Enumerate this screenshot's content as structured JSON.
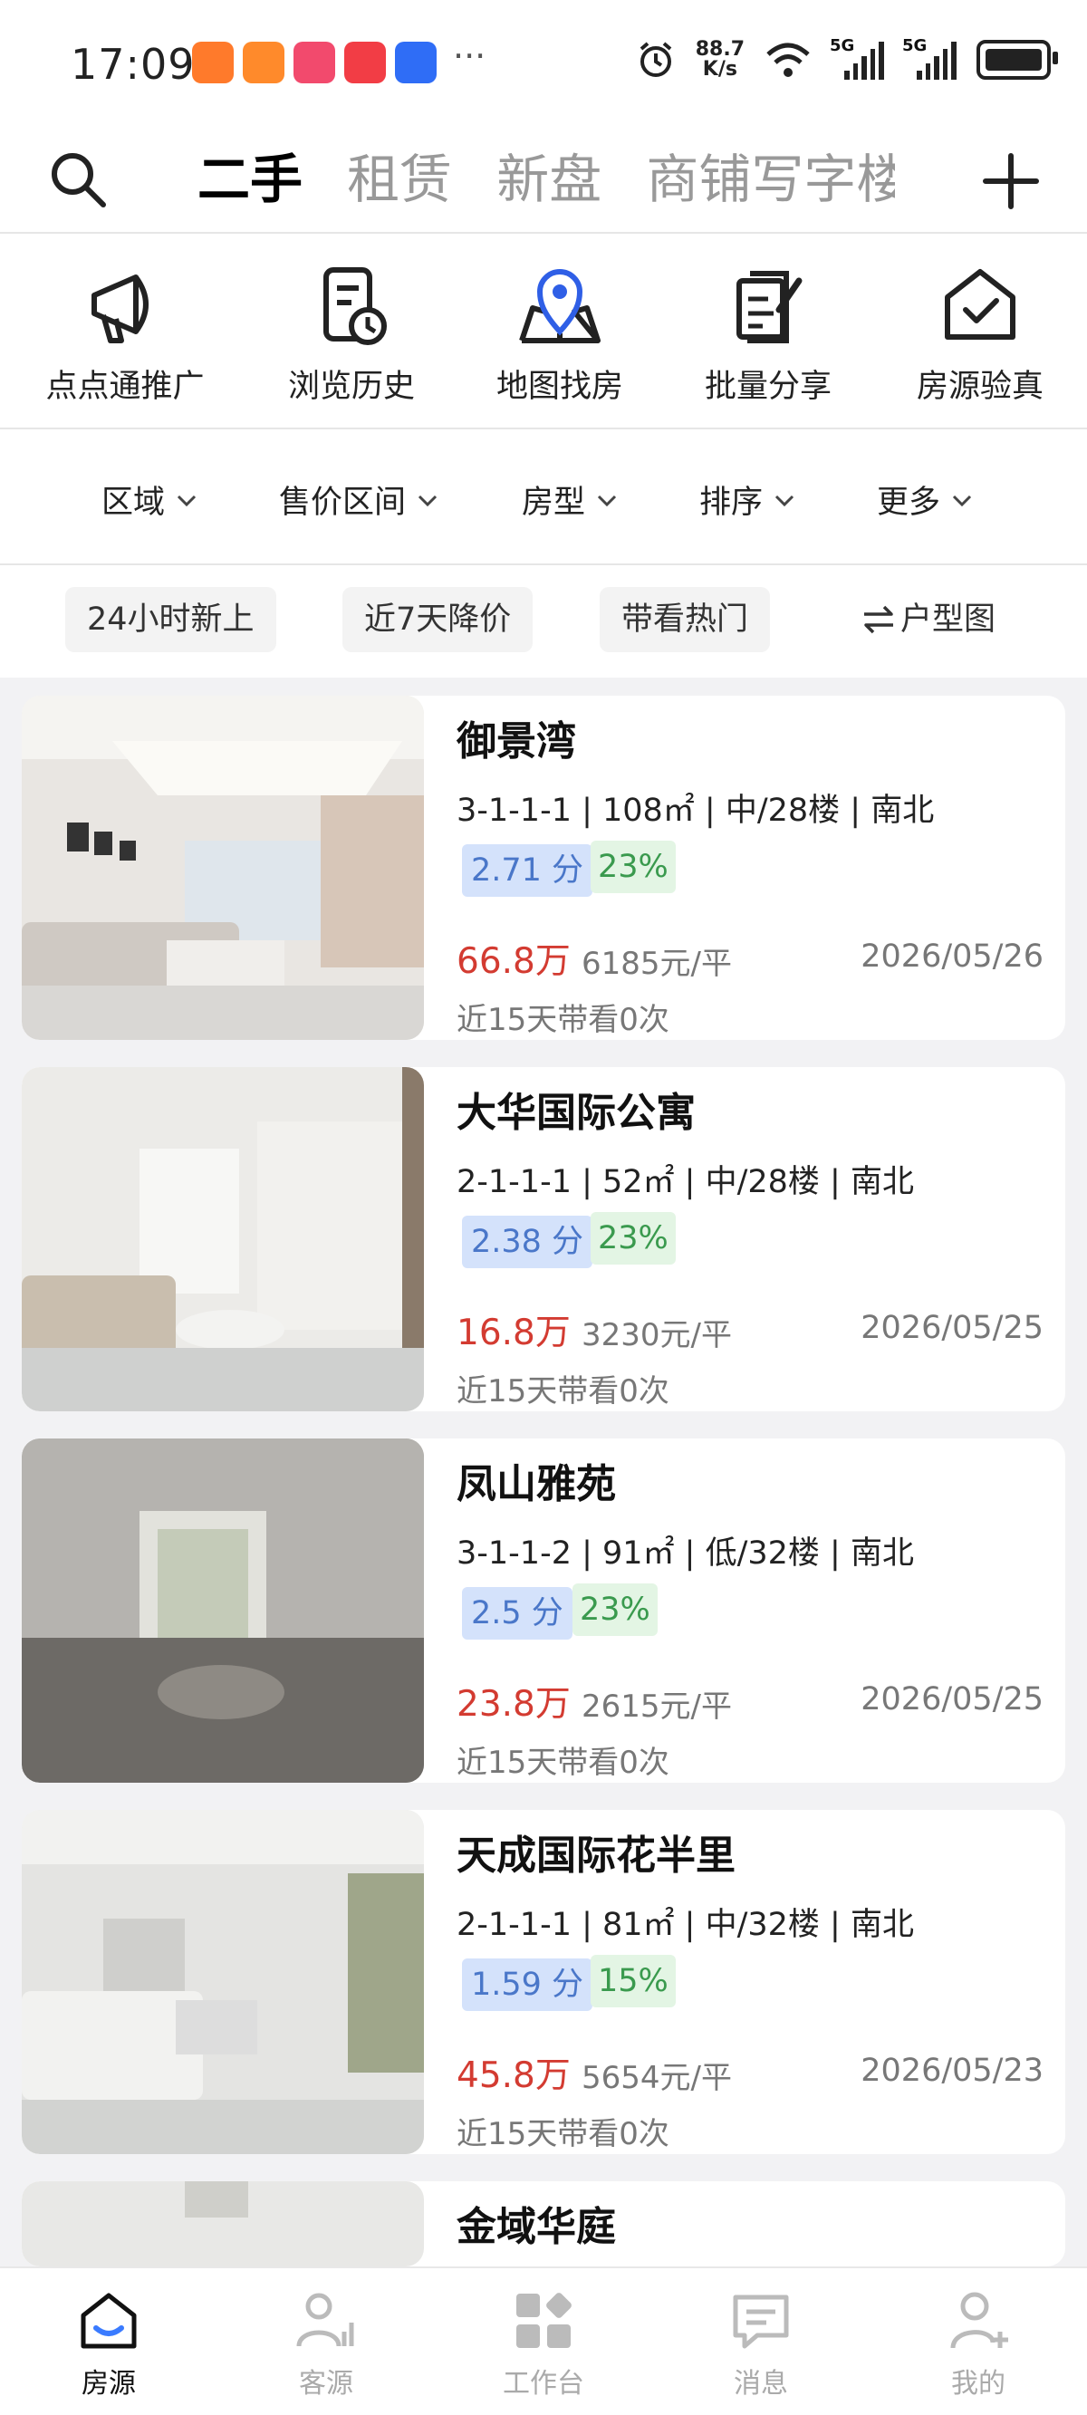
{
  "status": {
    "time": "17:09",
    "speed_value": "88.7",
    "speed_unit": "K/s",
    "net1": "5G",
    "net2": "5G",
    "more": "···"
  },
  "header": {
    "tabs": [
      "二手",
      "租赁",
      "新盘",
      "商铺写字楼"
    ]
  },
  "tools": [
    "点点通推广",
    "浏览历史",
    "地图找房",
    "批量分享",
    "房源验真"
  ],
  "filters": [
    "区域",
    "售价区间",
    "房型",
    "排序",
    "更多"
  ],
  "chips": [
    "24小时新上",
    "近7天降价",
    "带看热门",
    "户型图"
  ],
  "listings": [
    {
      "name": "御景湾",
      "spec": "3-1-1-1 | 108㎡ | 中/28楼 | 南北",
      "score": "2.71 分",
      "pct": "23%",
      "price": "66.8万",
      "unit": "6185元/平",
      "date": "2026/05/26",
      "views": "近15天带看0次"
    },
    {
      "name": "大华国际公寓",
      "spec": "2-1-1-1 | 52㎡ | 中/28楼 | 南北",
      "score": "2.38 分",
      "pct": "23%",
      "price": "16.8万",
      "unit": "3230元/平",
      "date": "2026/05/25",
      "views": "近15天带看0次"
    },
    {
      "name": "凤山雅苑",
      "spec": "3-1-1-2 | 91㎡ | 低/32楼 | 南北",
      "score": "2.5 分",
      "pct": "23%",
      "price": "23.8万",
      "unit": "2615元/平",
      "date": "2026/05/25",
      "views": "近15天带看0次"
    },
    {
      "name": "天成国际花半里",
      "spec": "2-1-1-1 | 81㎡ | 中/32楼 | 南北",
      "score": "1.59 分",
      "pct": "15%",
      "price": "45.8万",
      "unit": "5654元/平",
      "date": "2026/05/23",
      "views": "近15天带看0次"
    },
    {
      "name": "金域华庭"
    }
  ],
  "nav": [
    "房源",
    "客源",
    "工作台",
    "消息",
    "我的"
  ],
  "colors": {
    "price": "#d33b31",
    "score_bg": "#d4e2fb",
    "pct_bg": "#e3f5e4",
    "active_nav": "#3a7bff"
  }
}
